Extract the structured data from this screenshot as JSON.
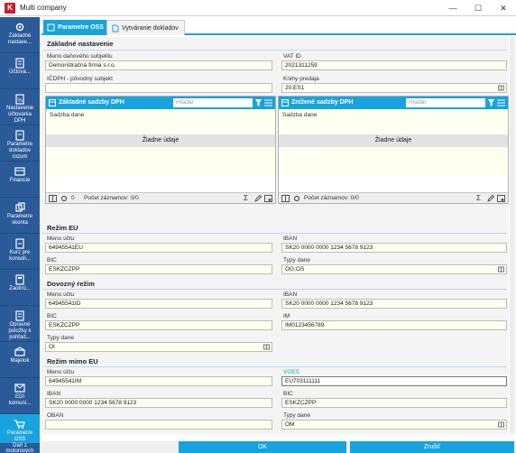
{
  "window": {
    "title": "Multi company",
    "app_icon_letter": "K",
    "minimize": "—",
    "maximize": "☐",
    "close": "✕"
  },
  "sidebar": {
    "items": [
      {
        "label": "Základné\nnastave...",
        "icon": "settings-icon"
      },
      {
        "label": "Účtova...",
        "icon": "ledger-icon"
      },
      {
        "label": "Nastavenie\núčtovania\nDPH",
        "icon": "tax-settings-icon"
      },
      {
        "label": "Parametre\ndokladov\nrozum",
        "icon": "document-params-icon"
      },
      {
        "label": "Financie",
        "icon": "finance-icon"
      },
      {
        "label": "Parametre\nskonta",
        "icon": "discount-icon"
      },
      {
        "label": "Kurz pre\nkonsoli...",
        "icon": "exchange-rate-icon"
      },
      {
        "label": "Zaokrú...",
        "icon": "rounding-icon"
      },
      {
        "label": "Opravné\npoložky k\npohľad...",
        "icon": "correction-icon"
      },
      {
        "label": "Majetok",
        "icon": "property-icon"
      },
      {
        "label": "EDI\nkomuni...",
        "icon": "edi-icon"
      },
      {
        "label": "Parametre\nOSS",
        "icon": "cart-icon"
      },
      {
        "label": "Daň z\nmotorových\nvozidiel",
        "icon": "vehicle-tax-icon"
      }
    ]
  },
  "tabs": [
    {
      "label": "Parametre OSS",
      "active": true
    },
    {
      "label": "Vytváranie dokladov",
      "active": false
    }
  ],
  "sections": {
    "basic": {
      "title": "Základné nastavenie",
      "company_label": "Meno daňového subjektu",
      "company_value": "Demonštračná firma s.r.o.",
      "vat_label": "VAT ID",
      "vat_value": "2021311259",
      "icdph_label": "IČDPH - pôvodný subjekt",
      "icdph_value": "",
      "books_label": "Knihy predaja",
      "books_value": "20;ES1"
    },
    "grid_left": {
      "title": "Základné sadzby DPH",
      "search_placeholder": "Hľadať",
      "column": "Sadzba dane",
      "empty": "Žiadne údaje",
      "count_zero": "0",
      "records": "Počet záznamov: 0/0"
    },
    "grid_right": {
      "title": "Znížené sadzby DPH",
      "search_placeholder": "Hľadať",
      "column": "Sadzba dane",
      "empty": "Žiadne údaje",
      "records": "Počet záznamov: 0/0"
    },
    "eu": {
      "title": "Režim EU",
      "account_label": "Meno účtu",
      "account_value": "64945541EU",
      "iban_label": "IBAN",
      "iban_value": "SK20 0000 0000 1234 5678 9123",
      "bic_label": "BIC",
      "bic_value": "ESKZCZPP",
      "tax_label": "Typy dane",
      "tax_value": "OG;OS"
    },
    "import": {
      "title": "Dovozný režim",
      "account_label": "Meno účtu",
      "account_value": "64945541ID",
      "iban_label": "IBAN",
      "iban_value": "SK20 0000 0000 1234 5678 9123",
      "bic_label": "BIC",
      "bic_value": "ESKZCZPP",
      "im_label": "IM",
      "im_value": "IM0123456789",
      "tax_label": "Typy dane",
      "tax_value": "OI"
    },
    "non_eu": {
      "title": "Režim mimo EU",
      "account_label": "Meno účtu",
      "account_value": "64945541IM",
      "voes_label": "VOES",
      "voes_value": "EU703111111",
      "iban_label": "IBAN",
      "iban_value": "SK20 0000 0000 1234 5678 9123",
      "bic_label": "BIC",
      "bic_value": "ESKZCZPP",
      "oban_label": "OBAN",
      "oban_value": "",
      "tax_label": "Typy dane",
      "tax_value": "OM"
    }
  },
  "buttons": {
    "ok": "OK",
    "cancel": "Zrušiť"
  },
  "colors": {
    "accent": "#17a3dd",
    "sidebar": "#2b5a99",
    "input_bg": "#fffff0",
    "brand_red": "#c8202f"
  }
}
